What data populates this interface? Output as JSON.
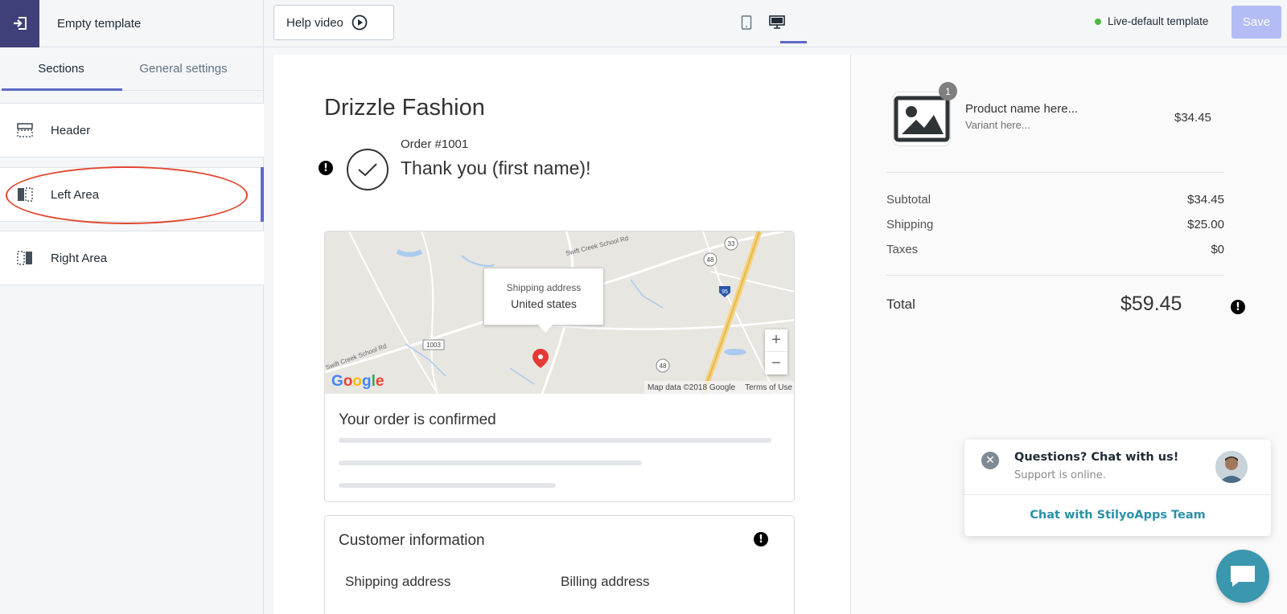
{
  "sidebar": {
    "title": "Empty template",
    "tabs": [
      {
        "label": "Sections"
      },
      {
        "label": "General settings"
      }
    ],
    "sections": [
      {
        "label": "Header"
      },
      {
        "label": "Left Area"
      },
      {
        "label": "Right Area"
      }
    ]
  },
  "topbar": {
    "help_label": "Help video",
    "status_label": "Live-default template",
    "save_label": "Save"
  },
  "preview": {
    "shop_name": "Drizzle Fashion",
    "order_number": "Order #1001",
    "thank_you": "Thank you (first name)!",
    "map": {
      "bubble_label": "Shipping address",
      "bubble_value": "United states",
      "road_labels": [
        "Swift Creek School Rd",
        "Swift Creek School Rd",
        "1003",
        "48",
        "48",
        "33",
        "95"
      ],
      "logo": "Google",
      "attribution": "Map data ©2018 Google",
      "terms": "Terms of Use",
      "zoom_in": "+",
      "zoom_out": "−"
    },
    "confirmed_title": "Your order is confirmed",
    "customer_title": "Customer information",
    "shipping_address_heading": "Shipping address",
    "billing_address_heading": "Billing address"
  },
  "summary": {
    "quantity": "1",
    "product_name": "Product name here...",
    "variant": "Variant here...",
    "price": "$34.45",
    "subtotal_label": "Subtotal",
    "subtotal_value": "$34.45",
    "shipping_label": "Shipping",
    "shipping_value": "$25.00",
    "taxes_label": "Taxes",
    "taxes_value": "$0",
    "total_label": "Total",
    "total_value": "$59.45"
  },
  "chat": {
    "title": "Questions? Chat with us!",
    "subtitle": "Support is online.",
    "link": "Chat with StilyoApps Team"
  },
  "colors": {
    "accent": "#5c6ac4",
    "exit_button": "#3f4079",
    "save_disabled": "#b3bcf5",
    "live_dot": "#50b83c",
    "highlight_oval": "#e0462d",
    "chat_accent": "#3a97ad"
  }
}
